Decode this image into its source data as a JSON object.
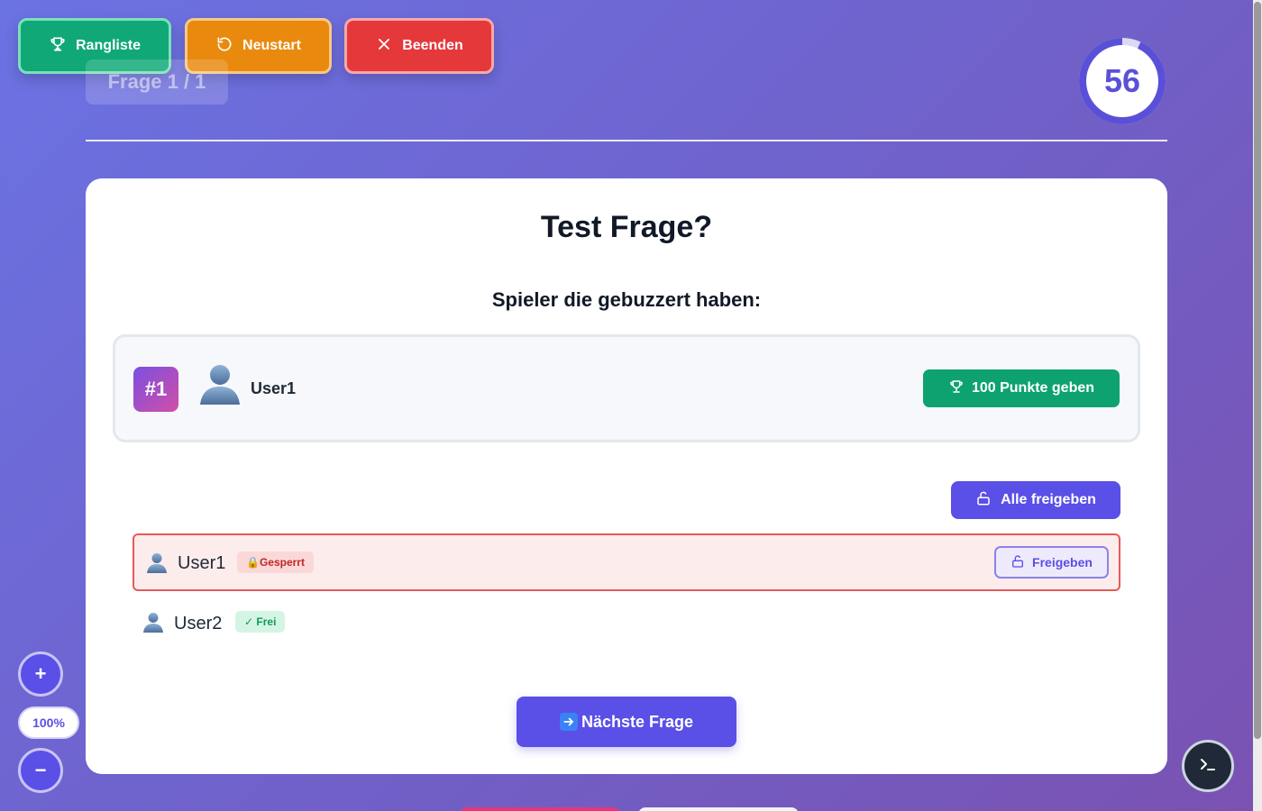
{
  "toolbar": {
    "rangliste_label": "Rangliste",
    "neustart_label": "Neustart",
    "beenden_label": "Beenden"
  },
  "header": {
    "question_counter": "Frage 1 / 1",
    "timer_value": "56",
    "timer_progress": 0.93
  },
  "question": {
    "text": "Test Frage?",
    "buzz_heading": "Spieler die gebuzzert haben:"
  },
  "buzzers": [
    {
      "rank": "#1",
      "name": "User1",
      "award_label": "100 Punkte geben"
    }
  ],
  "release_all_label": "Alle freigeben",
  "players": [
    {
      "name": "User1",
      "status": "🔒Gesperrt",
      "unlock_label": "Freigeben"
    },
    {
      "name": "User2",
      "status": "✓ Frei"
    }
  ],
  "next_question_label": "Nächste Frage",
  "zoom": {
    "plus": "+",
    "level": "100%",
    "minus": "−"
  },
  "colors": {
    "accent": "#5a4fe6",
    "success": "#0ea271",
    "warning": "#e98a0e",
    "danger": "#e5383b"
  },
  "icons": {
    "rangliste": "trophy-icon",
    "neustart": "restart-icon",
    "beenden": "close-icon",
    "award": "trophy-icon",
    "release": "unlock-icon",
    "next": "arrow-right-icon",
    "terminal": "terminal-icon"
  }
}
